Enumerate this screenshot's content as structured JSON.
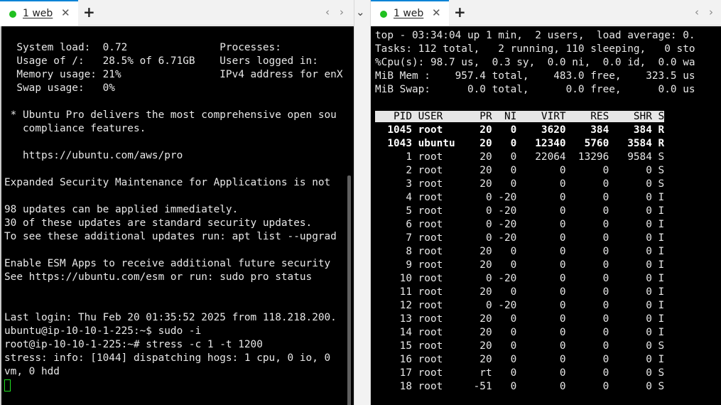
{
  "left_pane": {
    "tab": {
      "label": "1 web",
      "close": "✕",
      "dot_color": "#20c020"
    },
    "new_tab": "+",
    "nav": {
      "prev": "‹",
      "next": "›",
      "collapse": "⌄"
    },
    "terminal_lines": [
      "",
      "  System load:  0.72               Processes:",
      "  Usage of /:   28.5% of 6.71GB    Users logged in:",
      "  Memory usage: 21%                IPv4 address for enX",
      "  Swap usage:   0%",
      "",
      " * Ubuntu Pro delivers the most comprehensive open sou",
      "   compliance features.",
      "",
      "   https://ubuntu.com/aws/pro",
      "",
      "Expanded Security Maintenance for Applications is not",
      "",
      "98 updates can be applied immediately.",
      "30 of these updates are standard security updates.",
      "To see these additional updates run: apt list --upgrad",
      "",
      "Enable ESM Apps to receive additional future security",
      "See https://ubuntu.com/esm or run: sudo pro status",
      "",
      "",
      "Last login: Thu Feb 20 01:35:52 2025 from 118.218.200.",
      "ubuntu@ip-10-10-1-225:~$ sudo -i",
      "root@ip-10-10-1-225:~# stress -c 1 -t 1200",
      "stress: info: [1044] dispatching hogs: 1 cpu, 0 io, 0",
      "vm, 0 hdd"
    ]
  },
  "right_pane": {
    "tab": {
      "label": "1 web",
      "close": "✕",
      "dot_color": "#20c020"
    },
    "new_tab": "+",
    "nav": {
      "prev": "‹",
      "next": "›"
    },
    "summary_lines": [
      "top - 03:34:04 up 1 min,  2 users,  load average: 0.",
      "Tasks: 112 total,   2 running, 110 sleeping,   0 sto",
      "%Cpu(s): 98.7 us,  0.3 sy,  0.0 ni,  0.0 id,  0.0 wa",
      "MiB Mem :    957.4 total,    483.0 free,    323.5 us",
      "MiB Swap:      0.0 total,      0.0 free,      0.0 us"
    ],
    "table_header": "   PID USER      PR  NI    VIRT    RES    SHR S",
    "processes": [
      {
        "text": "  1045 root      20   0    3620    384    384 R",
        "bold": true
      },
      {
        "text": "  1043 ubuntu    20   0   12340   5760   3584 R",
        "bold": true
      },
      {
        "text": "     1 root      20   0   22064  13296   9584 S",
        "bold": false
      },
      {
        "text": "     2 root      20   0       0      0      0 S",
        "bold": false
      },
      {
        "text": "     3 root      20   0       0      0      0 S",
        "bold": false
      },
      {
        "text": "     4 root       0 -20       0      0      0 I",
        "bold": false
      },
      {
        "text": "     5 root       0 -20       0      0      0 I",
        "bold": false
      },
      {
        "text": "     6 root       0 -20       0      0      0 I",
        "bold": false
      },
      {
        "text": "     7 root       0 -20       0      0      0 I",
        "bold": false
      },
      {
        "text": "     8 root      20   0       0      0      0 I",
        "bold": false
      },
      {
        "text": "     9 root      20   0       0      0      0 I",
        "bold": false
      },
      {
        "text": "    10 root       0 -20       0      0      0 I",
        "bold": false
      },
      {
        "text": "    11 root      20   0       0      0      0 I",
        "bold": false
      },
      {
        "text": "    12 root       0 -20       0      0      0 I",
        "bold": false
      },
      {
        "text": "    13 root      20   0       0      0      0 I",
        "bold": false
      },
      {
        "text": "    14 root      20   0       0      0      0 I",
        "bold": false
      },
      {
        "text": "    15 root      20   0       0      0      0 S",
        "bold": false
      },
      {
        "text": "    16 root      20   0       0      0      0 I",
        "bold": false
      },
      {
        "text": "    17 root      rt   0       0      0      0 S",
        "bold": false
      },
      {
        "text": "    18 root     -51   0       0      0      0 S",
        "bold": false
      }
    ]
  }
}
